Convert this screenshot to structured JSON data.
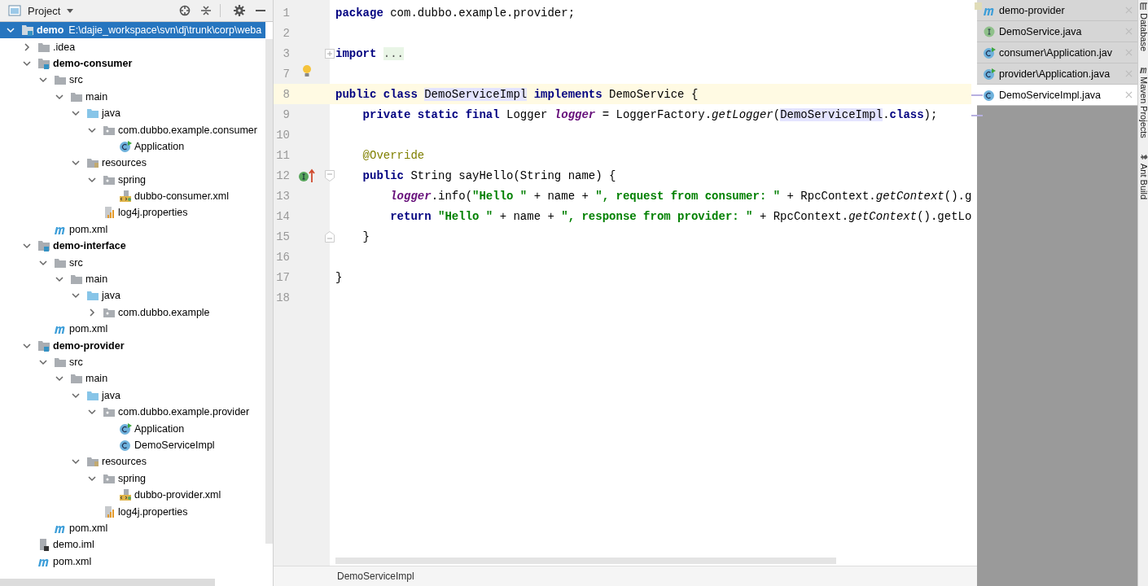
{
  "project_panel": {
    "title": "Project",
    "tree": [
      {
        "label": "demo",
        "path": "E:\\dajie_workspace\\svn\\dj\\trunk\\corp\\weba",
        "kind": "module",
        "expanded": true,
        "selected": true,
        "children": [
          {
            "label": ".idea",
            "kind": "folder",
            "expanded": false,
            "selected": false
          },
          {
            "label": "demo-consumer",
            "kind": "module",
            "expanded": true,
            "selected": false,
            "children": [
              {
                "label": "src",
                "kind": "folder",
                "expanded": true,
                "selected": false,
                "children": [
                  {
                    "label": "main",
                    "kind": "folder",
                    "expanded": true,
                    "selected": false,
                    "children": [
                      {
                        "label": "java",
                        "kind": "source-root",
                        "expanded": true,
                        "selected": false,
                        "children": [
                          {
                            "label": "com.dubbo.example.consumer",
                            "kind": "package",
                            "expanded": true,
                            "selected": false,
                            "children": [
                              {
                                "label": "Application",
                                "kind": "class-run",
                                "selected": false
                              }
                            ]
                          }
                        ]
                      },
                      {
                        "label": "resources",
                        "kind": "resources",
                        "expanded": true,
                        "selected": false,
                        "children": [
                          {
                            "label": "spring",
                            "kind": "package",
                            "expanded": true,
                            "selected": false,
                            "children": [
                              {
                                "label": "dubbo-consumer.xml",
                                "kind": "xml",
                                "selected": false
                              }
                            ]
                          },
                          {
                            "label": "log4j.properties",
                            "kind": "properties",
                            "selected": false
                          }
                        ]
                      }
                    ]
                  }
                ]
              },
              {
                "label": "pom.xml",
                "kind": "maven",
                "selected": false
              }
            ]
          },
          {
            "label": "demo-interface",
            "kind": "module",
            "expanded": true,
            "selected": false,
            "children": [
              {
                "label": "src",
                "kind": "folder",
                "expanded": true,
                "selected": false,
                "children": [
                  {
                    "label": "main",
                    "kind": "folder",
                    "expanded": true,
                    "selected": false,
                    "children": [
                      {
                        "label": "java",
                        "kind": "source-root",
                        "expanded": true,
                        "selected": false,
                        "children": [
                          {
                            "label": "com.dubbo.example",
                            "kind": "package",
                            "expanded": false,
                            "selected": false
                          }
                        ]
                      }
                    ]
                  }
                ]
              },
              {
                "label": "pom.xml",
                "kind": "maven",
                "selected": false
              }
            ]
          },
          {
            "label": "demo-provider",
            "kind": "module",
            "expanded": true,
            "selected": false,
            "children": [
              {
                "label": "src",
                "kind": "folder",
                "expanded": true,
                "selected": false,
                "children": [
                  {
                    "label": "main",
                    "kind": "folder",
                    "expanded": true,
                    "selected": false,
                    "children": [
                      {
                        "label": "java",
                        "kind": "source-root",
                        "expanded": true,
                        "selected": false,
                        "children": [
                          {
                            "label": "com.dubbo.example.provider",
                            "kind": "package",
                            "expanded": true,
                            "selected": false,
                            "children": [
                              {
                                "label": "Application",
                                "kind": "class-run",
                                "selected": false
                              },
                              {
                                "label": "DemoServiceImpl",
                                "kind": "class",
                                "selected": false
                              }
                            ]
                          }
                        ]
                      },
                      {
                        "label": "resources",
                        "kind": "resources",
                        "expanded": true,
                        "selected": false,
                        "children": [
                          {
                            "label": "spring",
                            "kind": "package",
                            "expanded": true,
                            "selected": false,
                            "children": [
                              {
                                "label": "dubbo-provider.xml",
                                "kind": "xml",
                                "selected": false
                              }
                            ]
                          },
                          {
                            "label": "log4j.properties",
                            "kind": "properties",
                            "selected": false
                          }
                        ]
                      }
                    ]
                  }
                ]
              },
              {
                "label": "pom.xml",
                "kind": "maven",
                "selected": false
              }
            ]
          },
          {
            "label": "demo.iml",
            "kind": "iml",
            "selected": false
          },
          {
            "label": "pom.xml",
            "kind": "maven",
            "selected": false
          }
        ]
      }
    ]
  },
  "editor": {
    "lines": [
      {
        "number": "1",
        "kind": "plain",
        "current": false,
        "tokens": [
          {
            "t": "package",
            "kind": "kw"
          },
          {
            "t": " com.dubbo.example.provider;",
            "kind": "plain"
          }
        ]
      },
      {
        "number": "2",
        "kind": "plain",
        "current": false
      },
      {
        "number": "3",
        "kind": "folded-import",
        "current": false,
        "tokens": [
          {
            "t": "import ",
            "kind": "kw"
          },
          {
            "t": "...",
            "kind": "folded"
          }
        ]
      },
      {
        "number": "7",
        "kind": "bulb",
        "current": false
      },
      {
        "number": "8",
        "kind": "plain",
        "current": true,
        "tokens": [
          {
            "t": "public class ",
            "kind": "kw"
          },
          {
            "t": "DemoServiceImpl",
            "kind": "ref"
          },
          {
            "t": " implements",
            "kind": "kw"
          },
          {
            "t": " DemoService {",
            "kind": "plain"
          }
        ]
      },
      {
        "number": "9",
        "kind": "plain",
        "current": false,
        "tokens": [
          {
            "t": "    private static final",
            "kind": "kw"
          },
          {
            "t": " Logger ",
            "kind": "plain"
          },
          {
            "t": "logger",
            "kind": "field"
          },
          {
            "t": " = LoggerFactory.",
            "kind": "plain"
          },
          {
            "t": "getLogger",
            "kind": "static"
          },
          {
            "t": "(",
            "kind": "plain"
          },
          {
            "t": "DemoServiceImpl",
            "kind": "ref"
          },
          {
            "t": ".",
            "kind": "plain"
          },
          {
            "t": "class",
            "kind": "kw"
          },
          {
            "t": ");",
            "kind": "plain"
          }
        ]
      },
      {
        "number": "10",
        "kind": "plain",
        "current": false
      },
      {
        "number": "11",
        "kind": "plain",
        "current": false,
        "tokens": [
          {
            "t": "    @Override",
            "kind": "ann"
          }
        ]
      },
      {
        "number": "12",
        "kind": "method-start",
        "current": false,
        "tokens": [
          {
            "t": "    public",
            "kind": "kw"
          },
          {
            "t": " String sayHello(String name) {",
            "kind": "plain"
          }
        ]
      },
      {
        "number": "13",
        "kind": "plain",
        "current": false,
        "tokens": [
          {
            "t": "        logger",
            "kind": "field"
          },
          {
            "t": ".info(",
            "kind": "plain"
          },
          {
            "t": "\"Hello \"",
            "kind": "str"
          },
          {
            "t": " + name + ",
            "kind": "plain"
          },
          {
            "t": "\", request from consumer: \"",
            "kind": "str"
          },
          {
            "t": " + RpcContext.",
            "kind": "plain"
          },
          {
            "t": "getContext",
            "kind": "static"
          },
          {
            "t": "().g",
            "kind": "plain"
          }
        ]
      },
      {
        "number": "14",
        "kind": "plain",
        "current": false,
        "tokens": [
          {
            "t": "        return",
            "kind": "kw"
          },
          {
            "t": " \"Hello \"",
            "kind": "str"
          },
          {
            "t": " + name + ",
            "kind": "plain"
          },
          {
            "t": "\", response from provider: \"",
            "kind": "str"
          },
          {
            "t": " + RpcContext.",
            "kind": "plain"
          },
          {
            "t": "getContext",
            "kind": "static"
          },
          {
            "t": "().getLo",
            "kind": "plain"
          }
        ]
      },
      {
        "number": "15",
        "kind": "block-end",
        "current": false,
        "tokens": [
          {
            "t": "    }",
            "kind": "plain"
          }
        ]
      },
      {
        "number": "16",
        "kind": "plain",
        "current": false
      },
      {
        "number": "17",
        "kind": "plain",
        "current": false,
        "tokens": [
          {
            "t": "}",
            "kind": "plain"
          }
        ]
      },
      {
        "number": "18",
        "kind": "plain",
        "current": false
      }
    ],
    "breadcrumb": "DemoServiceImpl"
  },
  "recent_files": [
    {
      "label": "demo-provider",
      "kind": "maven",
      "selected": false
    },
    {
      "label": "DemoService.java",
      "kind": "interface",
      "selected": false
    },
    {
      "label": "consumer\\Application.jav",
      "kind": "class-run",
      "selected": false
    },
    {
      "label": "provider\\Application.java",
      "kind": "class-run",
      "selected": false
    },
    {
      "label": "DemoServiceImpl.java",
      "kind": "class",
      "selected": true
    }
  ],
  "side_tools": [
    {
      "label": "Database",
      "kind": "database"
    },
    {
      "label": "Maven Projects",
      "kind": "maven"
    },
    {
      "label": "Ant Build",
      "kind": "ant"
    }
  ]
}
